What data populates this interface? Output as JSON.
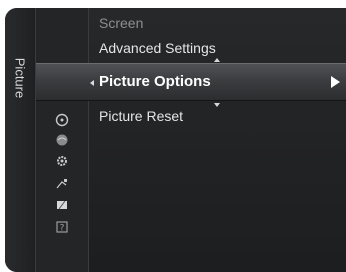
{
  "sidebar": {
    "category_label": "Picture"
  },
  "menu": {
    "items": [
      {
        "label": "Screen"
      },
      {
        "label": "Advanced Settings"
      },
      {
        "label": "Picture Options"
      },
      {
        "label": "Picture Reset"
      }
    ],
    "selected_index": 2
  },
  "icons": [
    "picture-icon",
    "circle-icon",
    "globe-icon",
    "gear-icon",
    "satellite-icon",
    "input-icon",
    "help-icon"
  ]
}
